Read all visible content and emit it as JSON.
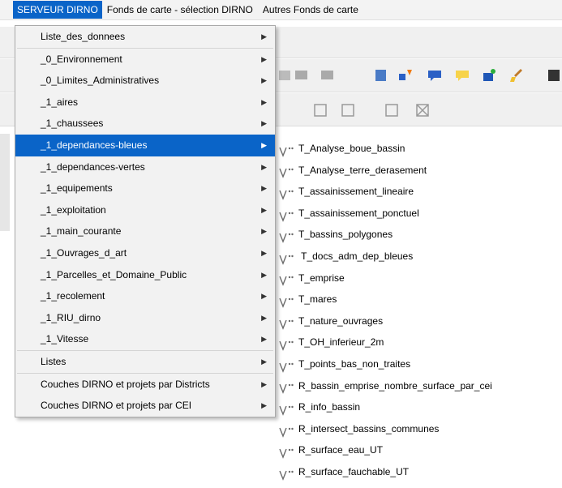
{
  "menubar": {
    "items": [
      {
        "label": "SERVEUR DIRNO",
        "active": true
      },
      {
        "label": "Fonds de carte - sélection DIRNO",
        "active": false
      },
      {
        "label": "Autres Fonds de carte",
        "active": false
      }
    ]
  },
  "main_menu": {
    "items": [
      {
        "label": "Liste_des_donnees"
      },
      {
        "separator": true
      },
      {
        "label": "_0_Environnement"
      },
      {
        "label": "_0_Limites_Administratives"
      },
      {
        "label": "_1_aires"
      },
      {
        "label": "_1_chaussees"
      },
      {
        "label": "_1_dependances-bleues",
        "highlighted": true
      },
      {
        "label": "_1_dependances-vertes"
      },
      {
        "label": "_1_equipements"
      },
      {
        "label": "_1_exploitation"
      },
      {
        "label": "_1_main_courante"
      },
      {
        "label": "_1_Ouvrages_d_art"
      },
      {
        "label": "_1_Parcelles_et_Domaine_Public"
      },
      {
        "label": "_1_recolement"
      },
      {
        "label": "_1_RIU_dirno"
      },
      {
        "label": "_1_Vitesse"
      },
      {
        "separator": true
      },
      {
        "label": "Listes"
      },
      {
        "separator": true
      },
      {
        "label": "Couches DIRNO et projets par Districts"
      },
      {
        "label": "Couches DIRNO et projets par CEI"
      }
    ]
  },
  "submenu": {
    "icon": "vector-layer-icon",
    "items": [
      "T_Analyse_boue_bassin",
      "T_Analyse_terre_derasement",
      "T_assainissement_lineaire",
      "T_assainissement_ponctuel",
      "T_bassins_polygones",
      " T_docs_adm_dep_bleues",
      "T_emprise",
      "T_mares",
      "T_nature_ouvrages",
      "T_OH_inferieur_2m",
      "T_points_bas_non_traites",
      "R_bassin_emprise_nombre_surface_par_cei",
      "R_info_bassin",
      "R_intersect_bassins_communes",
      "R_surface_eau_UT",
      "R_surface_fauchable_UT"
    ]
  },
  "colors": {
    "highlight": "#0a64c8",
    "menu_bg": "#f2f2f2"
  }
}
